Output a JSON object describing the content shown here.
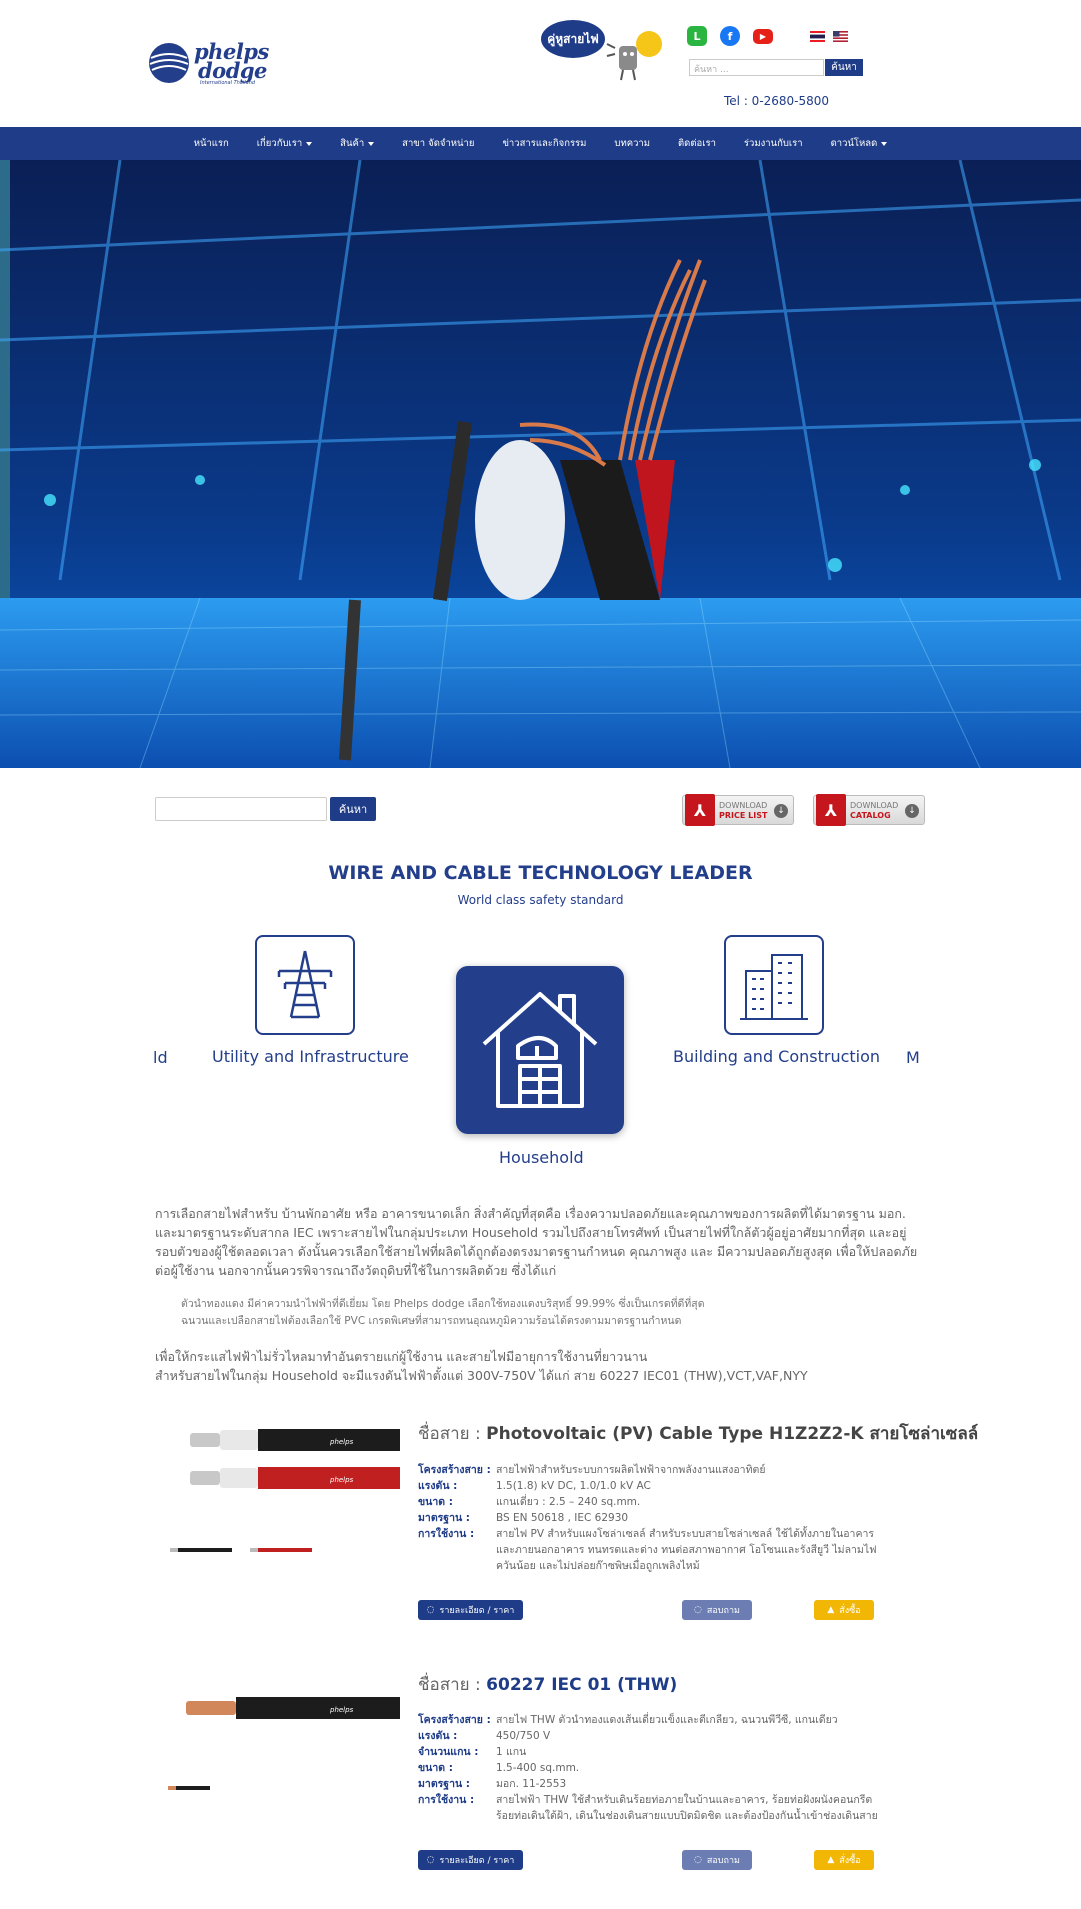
{
  "header": {
    "logo": {
      "line1": "phelps",
      "line2": "dodge",
      "sub": "International Thailand"
    },
    "guide_label": "คู่หูสายไฟ",
    "social": {
      "line": "L",
      "facebook": "f",
      "youtube": "▶"
    },
    "search_placeholder": "ค้นหา ...",
    "search_button": "ค้นหา",
    "tel": "Tel : 0-2680-5800"
  },
  "nav": {
    "items": [
      {
        "label": "หน้าแรก",
        "caret": false
      },
      {
        "label": "เกี่ยวกับเรา",
        "caret": true
      },
      {
        "label": "สินค้า",
        "caret": true
      },
      {
        "label": "สาขา จัดจำหน่าย",
        "caret": false
      },
      {
        "label": "ข่าวสารและกิจกรรม",
        "caret": false
      },
      {
        "label": "บทความ",
        "caret": false
      },
      {
        "label": "ติดต่อเรา",
        "caret": false
      },
      {
        "label": "ร่วมงานกับเรา",
        "caret": false
      },
      {
        "label": "ดาวน์โหลด",
        "caret": true
      }
    ]
  },
  "toolbar": {
    "search_button": "ค้นหา",
    "download_price": {
      "line1": "DOWNLOAD",
      "line2": "PRICE LIST"
    },
    "download_catalog": {
      "line1": "DOWNLOAD",
      "line2": "CATALOG"
    }
  },
  "tagline": {
    "title": "WIRE AND CABLE TECHNOLOGY LEADER",
    "subtitle": "World class safety standard"
  },
  "categories": {
    "left_partial": "ld",
    "right_partial": "M",
    "utility": "Utility and Infrastructure",
    "household": "Household",
    "building": "Building and Construction"
  },
  "intro": {
    "paragraph": "การเลือกสายไฟสำหรับ บ้านพักอาศัย หรือ อาคารขนาดเล็ก สิ่งสำคัญที่สุดคือ เรื่องความปลอดภัยและคุณภาพของการผลิตที่ได้มาตรฐาน มอก. และมาตรฐานระดับสากล IEC  เพราะสายไฟในกลุ่มประเภท Household รวมไปถึงสายโทรศัพท์ เป็นสายไฟที่ใกล้ตัวผู้อยู่อาศัยมากที่สุด และอยู่รอบตัวของผู้ใช้ตลอดเวลา ดังนั้นควรเลือกใช้สายไฟที่ผลิตได้ถูกต้องตรงมาตรฐานกำหนด คุณภาพสูง และ มีความปลอดภัยสูงสุด เพื่อให้ปลอดภัยต่อผู้ใช้งาน นอกจากนั้นควรพิจารณาถึงวัตถุดิบที่ใช้ในการผลิตด้วย ซึ่งได้แก่",
    "bullet1": "ตัวนำทองแดง มีค่าความนำไฟฟ้าที่ดีเยี่ยม โดย Phelps dodge เลือกใช้ทองแดงบริสุทธิ์ 99.99% ซึ่งเป็นเกรดที่ดีที่สุด",
    "bullet2": "ฉนวนและเปลือกสายไฟต้องเลือกใช้ PVC เกรดพิเศษที่สามารถทนอุณหภูมิความร้อนได้ตรงตามมาตรฐานกำหนด",
    "line3": "เพื่อให้กระแสไฟฟ้าไม่รั่วไหลมาทำอันตรายแก่ผู้ใช้งาน และสายไฟมีอายุการใช้งานที่ยาวนาน",
    "line4": "สำหรับสายไฟในกลุ่ม Household จะมีแรงดันไฟฟ้าตั้งแต่ 300V-750V ได้แก่ สาย 60227 IEC01 (THW),VCT,VAF,NYY"
  },
  "products": [
    {
      "name_prefix": "ชื่อสาย : ",
      "name": "Photovoltaic (PV) Cable Type H1Z2Z2-K สายโซล่าเซลล์",
      "specs": [
        {
          "k": "โครงสร้างสาย :",
          "v": "สายไฟฟ้าสำหรับระบบการผลิตไฟฟ้าจากพลังงานแสงอาทิตย์"
        },
        {
          "k": "แรงดัน :",
          "v": "1.5(1.8) kV DC, 1.0/1.0 kV AC"
        },
        {
          "k": "ขนาด :",
          "v": "แกนเดี่ยว : 2.5 – 240 sq.mm."
        },
        {
          "k": "มาตรฐาน :",
          "v": "BS EN 50618 , IEC 62930"
        },
        {
          "k": "การใช้งาน :",
          "v": "สายไฟ PV  สำหรับแผงโซล่าเซลล์ สำหรับระบบสายโซล่าเซลล์ ใช้ได้ทั้งภายในอาคารและภายนอกอาคาร ทนทรดและด่าง ทนต่อสภาพอากาศ โอโซนและรังสียูวี ไม่ลามไฟ ควันน้อย และไม่ปล่อยก๊าซพิษเมื่อถูกเพลิงไหม้"
        }
      ],
      "btn_detail": "รายละเอียด / ราคา",
      "btn_ask": "สอบถาม",
      "btn_order": "สั่งซื้อ"
    },
    {
      "name_prefix": "ชื่อสาย : ",
      "name": "60227 IEC 01 (THW)",
      "specs": [
        {
          "k": "โครงสร้างสาย :",
          "v": "สายไฟ THW ตัวนำทองแดงเส้นเดี่ยวแข็งและตีเกลียว, ฉนวนพีวีซี, แกนเดียว"
        },
        {
          "k": "แรงดัน :",
          "v": "450/750 V"
        },
        {
          "k": "จำนวนแกน :",
          "v": "1 แกน"
        },
        {
          "k": "ขนาด :",
          "v": "1.5-400 sq.mm."
        },
        {
          "k": "มาตรฐาน :",
          "v": "มอก. 11-2553"
        },
        {
          "k": "การใช้งาน :",
          "v": "สายไฟฟ้า THW ใช้สำหรับเดินร้อยท่อภายในบ้านและอาคาร, ร้อยท่อฝังผนังคอนกรีต ร้อยท่อเดินใต้ฝ้า, เดินในช่องเดินสายแบบปิดมิดชิด และต้องป้องกันน้ำเข้าช่องเดินสาย"
        }
      ],
      "btn_detail": "รายละเอียด / ราคา",
      "btn_ask": "สอบถาม",
      "btn_order": "สั่งซื้อ"
    }
  ],
  "colors": {
    "brand": "#1f3c88",
    "accent": "#f2b705",
    "pdf_red": "#c4161c"
  }
}
